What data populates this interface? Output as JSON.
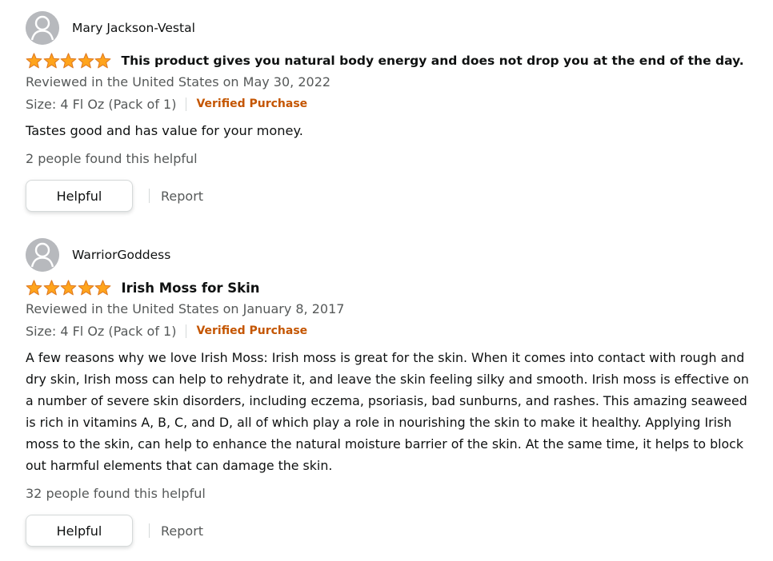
{
  "reviews": [
    {
      "profile_name": "Mary Jackson-Vestal",
      "rating": 5,
      "rating_max": 5,
      "title": "This product gives you natural body energy and does not drop you at the end of the day.",
      "date": "Reviewed in the United States on May 30, 2022",
      "size": "Size: 4 Fl Oz (Pack of 1)",
      "verified": "Verified Purchase",
      "body": "Tastes good and has value for your money.",
      "helpful_count": "2 people found this helpful",
      "helpful_label": "Helpful",
      "report_label": "Report"
    },
    {
      "profile_name": "WarriorGoddess",
      "rating": 5,
      "rating_max": 5,
      "title": "Irish Moss for Skin",
      "date": "Reviewed in the United States on January 8, 2017",
      "size": "Size: 4 Fl Oz (Pack of 1)",
      "verified": "Verified Purchase",
      "body": "A few reasons why we love Irish Moss: Irish moss is great for the skin. When it comes into contact with rough and dry skin, Irish moss can help to rehydrate it, and leave the skin feeling silky and smooth. Irish moss is effective on a number of severe skin disorders, including eczema, psoriasis, bad sunburns, and rashes. This amazing seaweed is rich in vitamins A, B, C, and D, all of which play a role in nourishing the skin to make it healthy. Applying Irish moss to the skin, can help to enhance the natural moisture barrier of the skin. At the same time, it helps to block out harmful elements that can damage the skin.",
      "helpful_count": "32 people found this helpful",
      "helpful_label": "Helpful",
      "report_label": "Report"
    }
  ],
  "colors": {
    "star": "#ffa41c",
    "star_outline": "#de7921",
    "verified": "#c45500",
    "secondary_text": "#565959",
    "avatar_bg": "#b7b9bd"
  },
  "icons": {
    "avatar": "default-profile-avatar-icon",
    "star": "star-icon"
  }
}
